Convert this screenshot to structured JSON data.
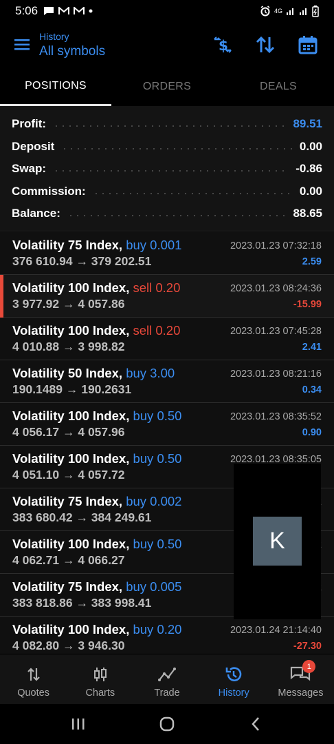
{
  "status_bar": {
    "time": "5:06",
    "network": "4G"
  },
  "header": {
    "subtitle": "History",
    "title": "All symbols",
    "icons": [
      "menu-icon",
      "dollar-swap-icon",
      "sort-icon",
      "calendar-icon"
    ]
  },
  "tabs": [
    {
      "label": "POSITIONS",
      "active": true
    },
    {
      "label": "ORDERS",
      "active": false
    },
    {
      "label": "DEALS",
      "active": false
    }
  ],
  "summary": [
    {
      "label": "Profit:",
      "value": "89.51",
      "color": "#3b8df0"
    },
    {
      "label": "Deposit",
      "value": "0.00"
    },
    {
      "label": "Swap:",
      "value": "-0.86"
    },
    {
      "label": "Commission:",
      "value": "0.00"
    },
    {
      "label": "Balance:",
      "value": "88.65"
    }
  ],
  "positions": [
    {
      "symbol": "Volatility 75 Index,",
      "side": "buy 0.001",
      "type": "buy",
      "prices": "376 610.94 → 379 202.51",
      "time": "2023.01.23 07:32:18",
      "profit": "2.59",
      "profit_sign": "pos"
    },
    {
      "symbol": "Volatility 100 Index,",
      "side": "sell 0.20",
      "type": "sell",
      "prices": "3 977.92 → 4 057.86",
      "time": "2023.01.23 08:24:36",
      "profit": "-15.99",
      "profit_sign": "neg"
    },
    {
      "symbol": "Volatility 100 Index,",
      "side": "sell 0.20",
      "type": "sell",
      "prices": "4 010.88 → 3 998.82",
      "time": "2023.01.23 07:45:28",
      "profit": "2.41",
      "profit_sign": "pos"
    },
    {
      "symbol": "Volatility 50 Index,",
      "side": "buy 3.00",
      "type": "buy",
      "prices": "190.1489 → 190.2631",
      "time": "2023.01.23 08:21:16",
      "profit": "0.34",
      "profit_sign": "pos"
    },
    {
      "symbol": "Volatility 100 Index,",
      "side": "buy 0.50",
      "type": "buy",
      "prices": "4 056.17 → 4 057.96",
      "time": "2023.01.23 08:35:52",
      "profit": "0.90",
      "profit_sign": "pos"
    },
    {
      "symbol": "Volatility 100 Index,",
      "side": "buy 0.50",
      "type": "buy",
      "prices": "4 051.10 → 4 057.72",
      "time": "2023.01.23 08:35:05",
      "profit": "",
      "profit_sign": "pos"
    },
    {
      "symbol": "Volatility 75 Index,",
      "side": "buy 0.002",
      "type": "buy",
      "prices": "383 680.42 → 384 249.61",
      "time": "2",
      "profit": "",
      "profit_sign": "pos"
    },
    {
      "symbol": "Volatility 100 Index,",
      "side": "buy 0.50",
      "type": "buy",
      "prices": "4 062.71 → 4 066.27",
      "time": "2",
      "profit": "",
      "profit_sign": "pos"
    },
    {
      "symbol": "Volatility 75 Index,",
      "side": "buy 0.005",
      "type": "buy",
      "prices": "383 818.86 → 383 998.41",
      "time": "2",
      "profit": "",
      "profit_sign": "pos"
    },
    {
      "symbol": "Volatility 100 Index,",
      "side": "buy 0.20",
      "type": "buy",
      "prices": "4 082.80 → 3 946.30",
      "time": "2023.01.24 21:14:40",
      "profit": "-27.30",
      "profit_sign": "neg"
    }
  ],
  "overlay": {
    "letter": "K"
  },
  "bottom_nav": [
    {
      "label": "Quotes",
      "icon": "quotes-icon",
      "active": false
    },
    {
      "label": "Charts",
      "icon": "charts-icon",
      "active": false
    },
    {
      "label": "Trade",
      "icon": "trade-icon",
      "active": false
    },
    {
      "label": "History",
      "icon": "history-icon",
      "active": true
    },
    {
      "label": "Messages",
      "icon": "messages-icon",
      "active": false,
      "badge": "1"
    }
  ],
  "colors": {
    "accent": "#3b8df0",
    "sell": "#e8483a"
  }
}
